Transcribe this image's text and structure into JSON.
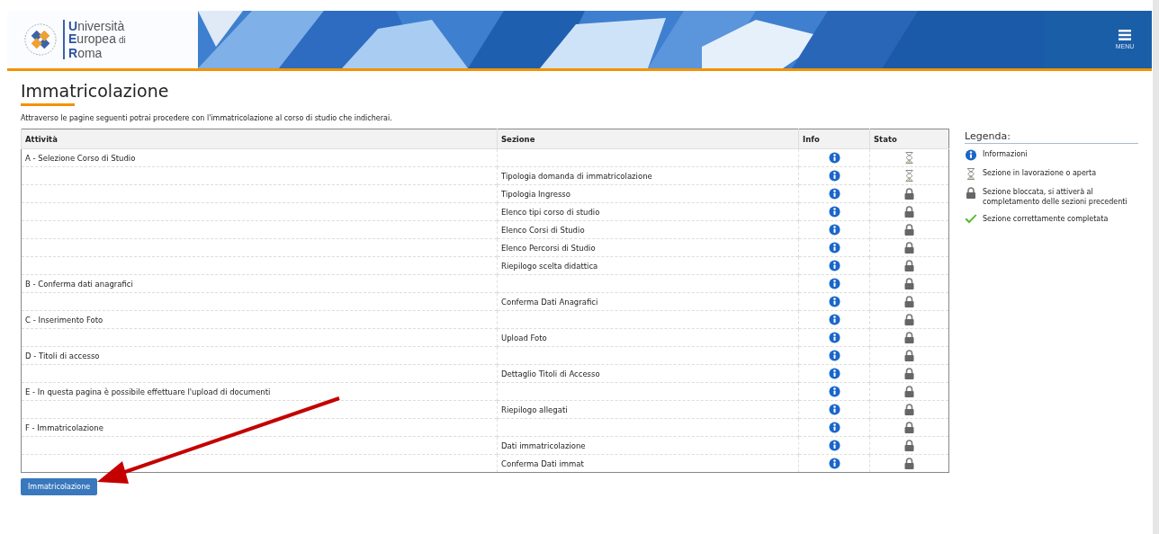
{
  "header": {
    "logo": {
      "lines": [
        {
          "text": "Università"
        },
        {
          "text": "Europea",
          "suffix": "di"
        },
        {
          "text": "Roma"
        }
      ]
    },
    "menu": {
      "label": "MENU"
    }
  },
  "page": {
    "title": "Immatricolazione",
    "intro": "Attraverso le pagine seguenti potrai procedere con l'immatricolazione al corso di studio che indicherai."
  },
  "table": {
    "columns": [
      "Attività",
      "Sezione",
      "Info",
      "Stato"
    ],
    "rows": [
      {
        "activity": "A - Selezione Corso di Studio",
        "locked": false
      },
      {
        "section": "Tipologia domanda di immatricolazione",
        "locked": false
      },
      {
        "section": "Tipologia Ingresso",
        "locked": true
      },
      {
        "section": "Elenco tipi corso di studio",
        "locked": true
      },
      {
        "section": "Elenco Corsi di Studio",
        "locked": true
      },
      {
        "section": "Elenco Percorsi di Studio",
        "locked": true
      },
      {
        "section": "Riepilogo scelta didattica",
        "locked": true
      },
      {
        "activity": "B - Conferma dati anagrafici",
        "locked": true
      },
      {
        "section": "Conferma Dati Anagrafici",
        "locked": true
      },
      {
        "activity": "C - Inserimento Foto",
        "locked": true
      },
      {
        "section": "Upload Foto",
        "locked": true
      },
      {
        "activity": "D - Titoli di accesso",
        "locked": true
      },
      {
        "section": "Dettaglio Titoli di Accesso",
        "locked": true
      },
      {
        "activity": "E - In questa pagina è possibile effettuare l'upload di documenti",
        "locked": true
      },
      {
        "section": "Riepilogo allegati",
        "locked": true
      },
      {
        "activity": "F - Immatricolazione",
        "locked": true
      },
      {
        "section": "Dati immatricolazione",
        "locked": true
      },
      {
        "section": "Conferma Dati immat",
        "locked": true
      }
    ]
  },
  "button": {
    "label": "Immatricolazione"
  },
  "legend": {
    "title": "Legenda:",
    "items": [
      {
        "kind": "info",
        "text": "Informazioni"
      },
      {
        "kind": "open",
        "text": "Sezione in lavorazione o aperta"
      },
      {
        "kind": "locked",
        "text": "Sezione bloccata, si attiverà al completamento delle sezioni precedenti"
      },
      {
        "kind": "done",
        "text": "Sezione correttamente completata"
      }
    ]
  }
}
